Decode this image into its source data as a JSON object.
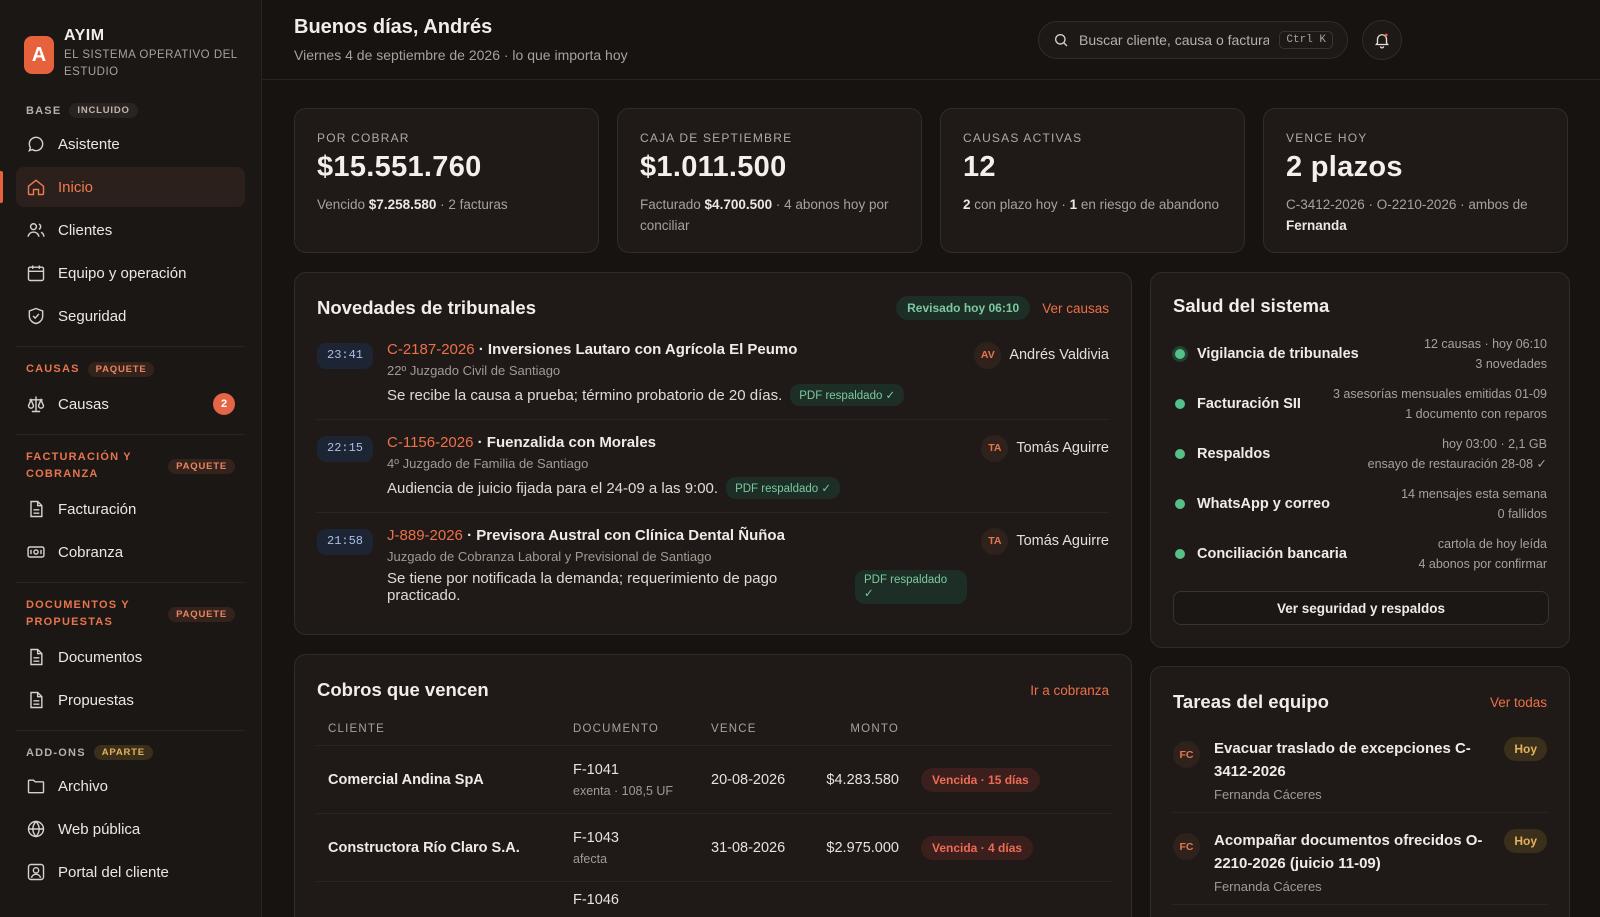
{
  "brand": {
    "logo_letter": "A",
    "name": "AYIM",
    "subtitle": "EL SISTEMA OPERATIVO DEL ESTUDIO",
    "accent_color": "#e6623c"
  },
  "sidebar": {
    "sections": [
      {
        "title": "BASE",
        "tag": "INCLUIDO",
        "items": [
          {
            "label": "Asistente",
            "icon": "chat-icon"
          },
          {
            "label": "Inicio",
            "icon": "home-icon",
            "active": true
          },
          {
            "label": "Clientes",
            "icon": "users-icon"
          },
          {
            "label": "Equipo y operación",
            "icon": "calendar-icon"
          },
          {
            "label": "Seguridad",
            "icon": "shield-icon"
          }
        ]
      },
      {
        "title": "CAUSAS",
        "tag": "PAQUETE",
        "items": [
          {
            "label": "Causas",
            "icon": "scale-icon",
            "badge": "2"
          }
        ]
      },
      {
        "title": "FACTURACIÓN Y COBRANZA",
        "tag": "PAQUETE",
        "items": [
          {
            "label": "Facturación",
            "icon": "document-icon"
          },
          {
            "label": "Cobranza",
            "icon": "cash-icon"
          }
        ]
      },
      {
        "title": "DOCUMENTOS Y PROPUESTAS",
        "tag": "PAQUETE",
        "items": [
          {
            "label": "Documentos",
            "icon": "document-icon"
          },
          {
            "label": "Propuestas",
            "icon": "document-icon"
          }
        ]
      },
      {
        "title": "ADD-ONS",
        "tag": "APARTE",
        "items": [
          {
            "label": "Archivo",
            "icon": "folder-icon"
          },
          {
            "label": "Web pública",
            "icon": "globe-icon"
          },
          {
            "label": "Portal del cliente",
            "icon": "user-portal-icon"
          }
        ]
      }
    ]
  },
  "header": {
    "greeting": "Buenos días, Andrés",
    "subtitle": "Viernes 4 de septiembre de 2026 · lo que importa hoy",
    "search_placeholder": "Buscar cliente, causa o factura...",
    "search_shortcut": "Ctrl K"
  },
  "kpis": [
    {
      "label": "POR COBRAR",
      "value": "$15.551.760",
      "desc": [
        {
          "t": "Vencido "
        },
        {
          "t": "$7.258.580",
          "b": true
        },
        {
          "t": " · 2 facturas"
        }
      ]
    },
    {
      "label": "CAJA DE SEPTIEMBRE",
      "value": "$1.011.500",
      "desc": [
        {
          "t": "Facturado "
        },
        {
          "t": "$4.700.500",
          "b": true
        },
        {
          "t": " · 4 abonos hoy por conciliar"
        }
      ]
    },
    {
      "label": "CAUSAS ACTIVAS",
      "value": "12",
      "desc": [
        {
          "t": "2",
          "b": true
        },
        {
          "t": " con plazo hoy · "
        },
        {
          "t": "1",
          "b": true
        },
        {
          "t": " en riesgo de abandono"
        }
      ]
    },
    {
      "label": "VENCE HOY",
      "value": "2 plazos",
      "desc": [
        {
          "t": "C-3412-2026 · O-2210-2026 · ambos de "
        },
        {
          "t": "Fernanda",
          "b": true
        }
      ]
    }
  ],
  "novedades": {
    "title": "Novedades de tribunales",
    "status": "Revisado hoy 06:10",
    "link": "Ver causas",
    "items": [
      {
        "time": "23:41",
        "code": "C-2187-2026",
        "parties": " · Inversiones Lautaro con Agrícola El Peumo",
        "court": "22º Juzgado Civil de Santiago",
        "text": "Se recibe la causa a prueba; término probatorio de 20 días.",
        "pdf": "PDF respaldado ✓",
        "initials": "AV",
        "person": "Andrés Valdivia"
      },
      {
        "time": "22:15",
        "code": "C-1156-2026",
        "parties": " · Fuenzalida con Morales",
        "court": "4º Juzgado de Familia de Santiago",
        "text": "Audiencia de juicio fijada para el 24-09 a las 9:00.",
        "pdf": "PDF respaldado ✓",
        "initials": "TA",
        "person": "Tomás Aguirre"
      },
      {
        "time": "21:58",
        "code": "J-889-2026",
        "parties": " · Previsora Austral con Clínica Dental Ñuñoa",
        "court": "Juzgado de Cobranza Laboral y Previsional de Santiago",
        "text": "Se tiene por notificada la demanda; requerimiento de pago practicado.",
        "pdf": "PDF respaldado ✓",
        "initials": "TA",
        "person": "Tomás Aguirre"
      }
    ]
  },
  "cobros": {
    "title": "Cobros que vencen",
    "link": "Ir a cobranza",
    "columns": [
      "CLIENTE",
      "DOCUMENTO",
      "VENCE",
      "MONTO"
    ],
    "rows": [
      {
        "client": "Comercial Andina SpA",
        "doc": "F-1041",
        "doc_sub": "exenta · 108,5 UF",
        "due": "20-08-2026",
        "amount": "$4.283.580",
        "status": "Vencida · 15 días"
      },
      {
        "client": "Constructora Río Claro S.A.",
        "doc": "F-1043",
        "doc_sub": "afecta",
        "due": "31-08-2026",
        "amount": "$2.975.000",
        "status": "Vencida · 4 días"
      },
      {
        "client": "",
        "doc": "F-1046",
        "doc_sub": "",
        "due": "",
        "amount": "",
        "status": ""
      }
    ]
  },
  "salud": {
    "title": "Salud del sistema",
    "items": [
      {
        "name": "Vigilancia de tribunales",
        "meta1": "12 causas · hoy 06:10",
        "meta2": "3 novedades"
      },
      {
        "name": "Facturación SII",
        "meta1": "3 asesorías mensuales emitidas 01-09",
        "meta2": "1 documento con reparos"
      },
      {
        "name": "Respaldos",
        "meta1": "hoy 03:00 · 2,1 GB",
        "meta2": "ensayo de restauración 28-08 ✓"
      },
      {
        "name": "WhatsApp y correo",
        "meta1": "14 mensajes esta semana",
        "meta2": "0 fallidos"
      },
      {
        "name": "Conciliación bancaria",
        "meta1": "cartola de hoy leída",
        "meta2": "4 abonos por confirmar"
      }
    ],
    "button": "Ver seguridad y respaldos"
  },
  "tareas": {
    "title": "Tareas del equipo",
    "link": "Ver todas",
    "items": [
      {
        "initials": "FC",
        "title": "Evacuar traslado de excepciones C-3412-2026",
        "person": "Fernanda Cáceres",
        "when": "Hoy"
      },
      {
        "initials": "FC",
        "title": "Acompañar documentos ofrecidos O-2210-2026 (juicio 11-09)",
        "person": "Fernanda Cáceres",
        "when": "Hoy"
      }
    ]
  }
}
